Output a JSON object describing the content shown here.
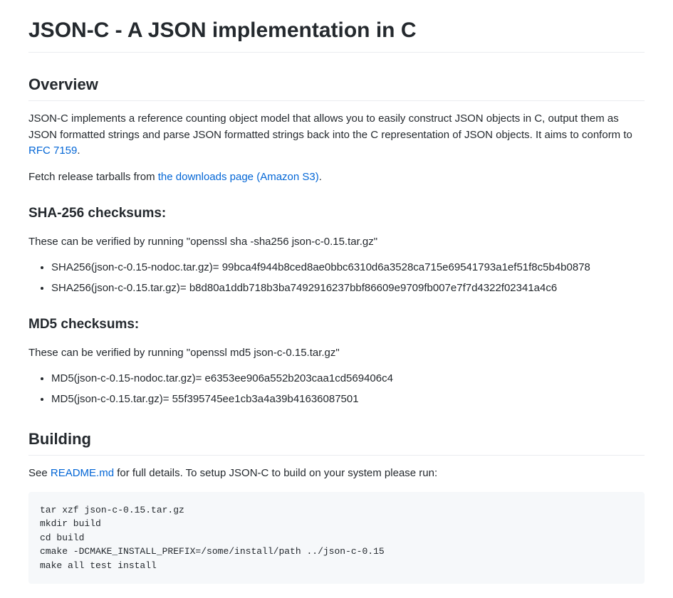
{
  "title": "JSON-C - A JSON implementation in C",
  "overview": {
    "heading": "Overview",
    "intro_part1": "JSON-C implements a reference counting object model that allows you to easily construct JSON objects in C, output them as JSON formatted strings and parse JSON formatted strings back into the C representation of JSON objects. It aims to conform to ",
    "rfc_link": "RFC 7159",
    "intro_part2": ".",
    "fetch_part1": "Fetch release tarballs from ",
    "fetch_link": "the downloads page (Amazon S3)",
    "fetch_part2": "."
  },
  "sha256": {
    "heading": "SHA-256 checksums:",
    "verify_text": "These can be verified by running \"openssl sha -sha256 json-c-0.15.tar.gz\"",
    "items": [
      "SHA256(json-c-0.15-nodoc.tar.gz)= 99bca4f944b8ced8ae0bbc6310d6a3528ca715e69541793a1ef51f8c5b4b0878",
      "SHA256(json-c-0.15.tar.gz)= b8d80a1ddb718b3ba7492916237bbf86609e9709fb007e7f7d4322f02341a4c6"
    ]
  },
  "md5": {
    "heading": "MD5 checksums:",
    "verify_text": "These can be verified by running \"openssl md5 json-c-0.15.tar.gz\"",
    "items": [
      "MD5(json-c-0.15-nodoc.tar.gz)= e6353ee906a552b203caa1cd569406c4",
      "MD5(json-c-0.15.tar.gz)= 55f395745ee1cb3a4a39b41636087501"
    ]
  },
  "building": {
    "heading": "Building",
    "see_part1": "See ",
    "readme_link": "README.md",
    "see_part2": " for full details. To setup JSON-C to build on your system please run:",
    "code": "tar xzf json-c-0.15.tar.gz\nmkdir build\ncd build\ncmake -DCMAKE_INSTALL_PREFIX=/some/install/path ../json-c-0.15\nmake all test install"
  }
}
